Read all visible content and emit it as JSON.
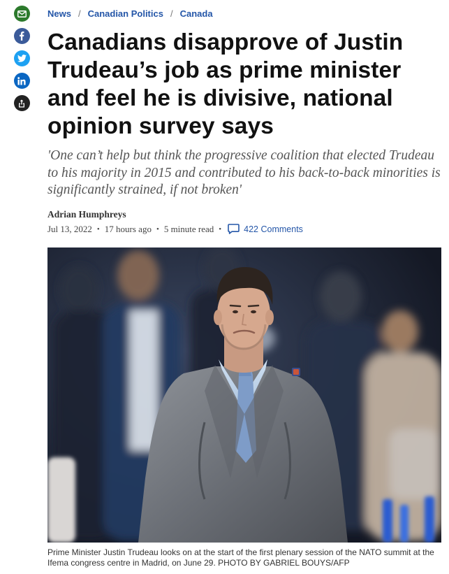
{
  "share": [
    {
      "name": "email-share",
      "icon": "envelope-icon",
      "color": "#2c7a2c"
    },
    {
      "name": "facebook-share",
      "icon": "facebook-icon",
      "color": "#3b5b9a"
    },
    {
      "name": "twitter-share",
      "icon": "twitter-icon",
      "color": "#1da1f2"
    },
    {
      "name": "linkedin-share",
      "icon": "linkedin-icon",
      "color": "#0a66c2"
    },
    {
      "name": "more-share",
      "icon": "share-icon",
      "color": "#222222"
    }
  ],
  "breadcrumb": {
    "items": [
      "News",
      "Canadian Politics",
      "Canada"
    ],
    "separator": "/"
  },
  "article": {
    "headline": "Canadians disapprove of Justin Trudeau’s job as prime minister and feel he is divisive, national opinion survey says",
    "subhead": "'One can’t help but think the progressive coalition that elected Trudeau to his majority in 2015 and contributed to his back-to-back minorities is significantly strained, if not broken'",
    "author": "Adrian Humphreys",
    "date": "Jul 13, 2022",
    "relative_time": "17 hours ago",
    "read_time": "5 minute read",
    "comments": "422 Comments",
    "link_color": "#2456a8"
  },
  "photo": {
    "caption": "Prime Minister Justin Trudeau looks on at the start of the first plenary session of the NATO summit at the Ifema congress centre in Madrid, on June 29. PHOTO BY GABRIEL BOUYS/AFP"
  }
}
